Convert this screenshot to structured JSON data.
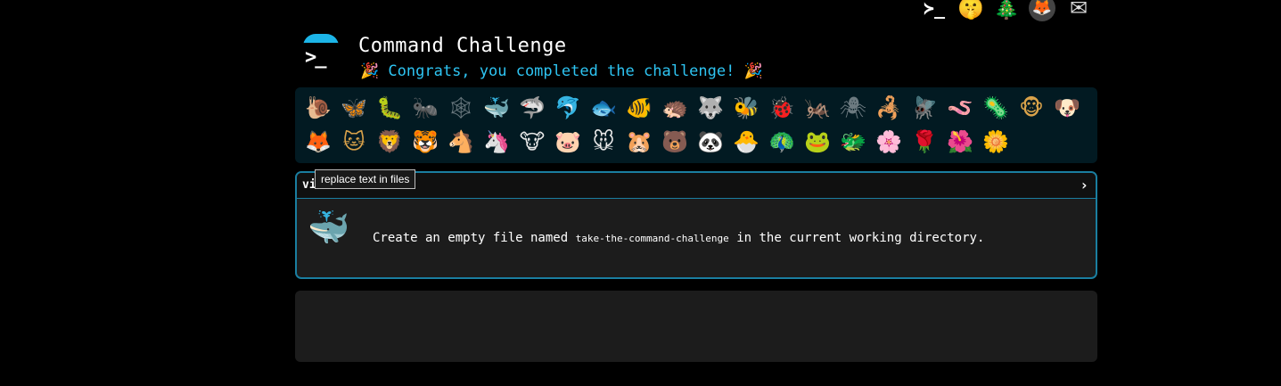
{
  "top_icons": [
    "terminal-icon",
    "shushing-face-icon",
    "tree-icon",
    "gitlab-icon",
    "mail-icon"
  ],
  "top_glyphs": {
    "terminal": "≻_",
    "face": "🤫",
    "tree": "🎄",
    "gitlab": "🦊",
    "mail": "✉"
  },
  "header": {
    "title": "Command Challenge",
    "subtitle": "Congrats, you completed the challenge!",
    "party_left": "🎉",
    "party_right": "🎉"
  },
  "animals_row1": [
    "🐌",
    "🦋",
    "🐛",
    "🐜",
    "🕸",
    "🐳",
    "🦈",
    "🐬",
    "🐟",
    "🐠",
    "🦔",
    "🐺",
    "🐝",
    "🐞",
    "🦗",
    "🕷",
    "🦂",
    "🪰",
    "🪱",
    "🦠",
    "🐵",
    "🐶"
  ],
  "animals_row2": [
    "🦊",
    "🐱",
    "🦁",
    "🐯",
    "🐴",
    "🦄",
    "🐮",
    "🐷",
    "🐭",
    "🐹",
    "🐻",
    "🐼",
    "🐣",
    "🦚",
    "🐸",
    "🐲",
    "🌸",
    "🌹",
    "🌺",
    "🌼"
  ],
  "challenge": {
    "name": "vi",
    "arrow": "›",
    "whale": "🐳",
    "text_before": "Create an empty file named",
    "filename": "take-the-command-challenge",
    "text_after": "in the current working directory."
  },
  "tooltip": "replace text in files",
  "colors": {
    "accent": "#2ec4f2",
    "border": "#1a7ea0",
    "bar_bg": "#021a22"
  }
}
